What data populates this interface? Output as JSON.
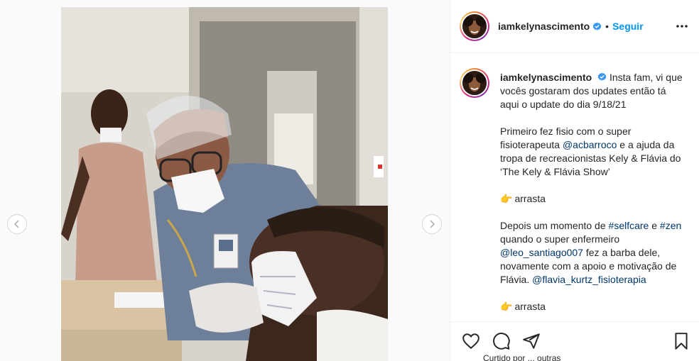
{
  "post": {
    "username": "iamkelynascimento",
    "follow_label": "Seguir",
    "separator": "•"
  },
  "caption": {
    "username": "iamkelynascimento",
    "line1": "Insta fam, vi que vocês gostaram dos updates então tá aqui o update do dia 9/18/21",
    "p2_a": "Primeiro fez fisio com o super fisioterapeuta ",
    "p2_mention": "@acbarroco",
    "p2_b": " e a ajuda da tropa de recreacionistas Kely & Flávia do ‘The Kely & Flávia Show’",
    "arrasta1": "arrasta",
    "p3_a": "Depois um momento de ",
    "p3_tag1": "#selfcare",
    "p3_b": " e ",
    "p3_tag2": "#zen",
    "p3_c": " quando o super enfermeiro ",
    "p3_mention1": "@leo_santiago007",
    "p3_d": " fez a barba dele, novamente com a apoio e motivação de Flávia. ",
    "p3_mention2": "@flavia_kurtz_fisioterapia",
    "arrasta2": "arrasta",
    "emoji": "👉"
  },
  "footer": {
    "partial_text": "Curtido por ... outras"
  },
  "icons": {
    "heart": "heart-icon",
    "comment": "comment-icon",
    "share": "share-icon",
    "save": "bookmark-icon",
    "more": "more-icon",
    "prev": "chevron-left-icon",
    "next": "chevron-right-icon",
    "verified": "verified-badge-icon"
  },
  "colors": {
    "link": "#00376b",
    "follow": "#0095f6",
    "verified": "#3897f0",
    "text": "#262626"
  }
}
